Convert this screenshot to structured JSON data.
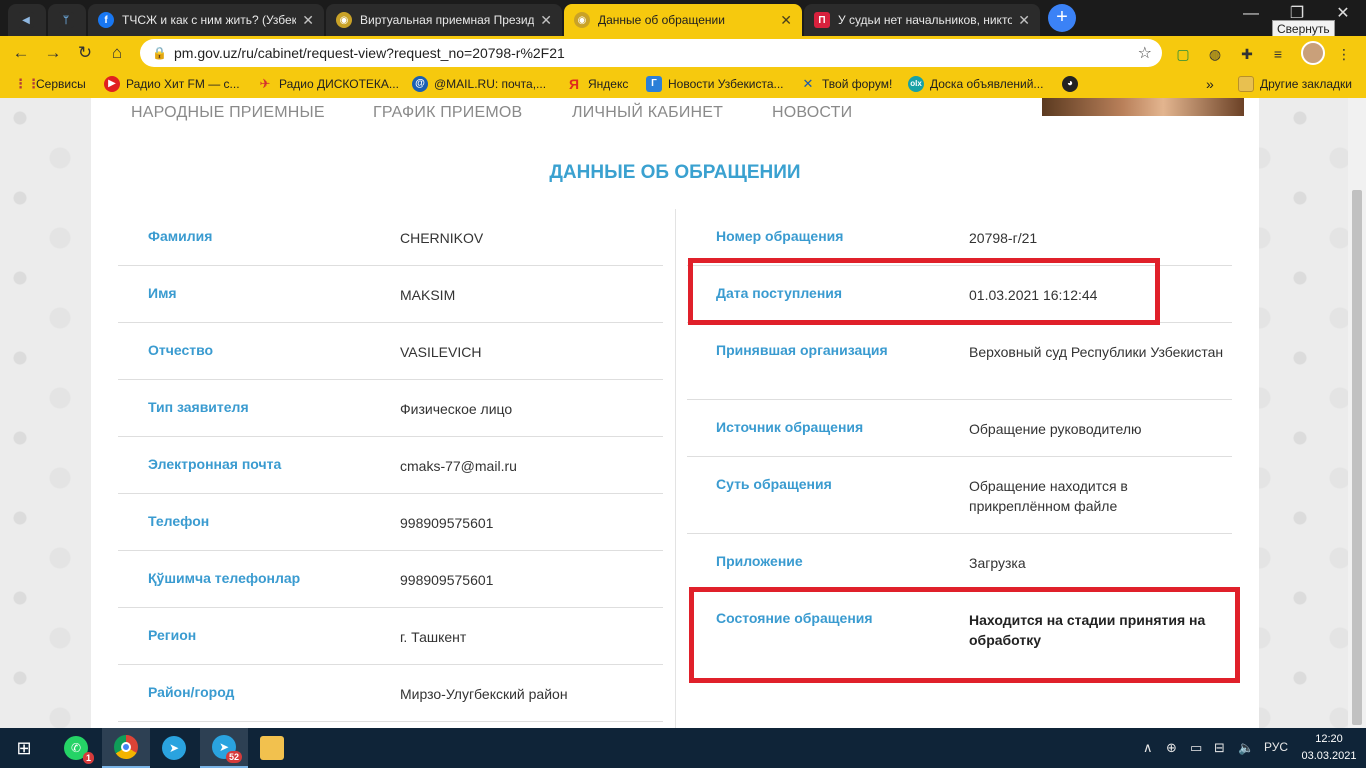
{
  "browser": {
    "tabs": [
      {
        "title": "",
        "favicon": "speaker-icon"
      },
      {
        "title": "",
        "favicon": "tree-icon"
      },
      {
        "title": "ТЧСЖ и как с ним жить? (Узбекистан)",
        "favicon": "facebook-icon"
      },
      {
        "title": "Виртуальная приемная Президента",
        "favicon": "emblem-icon"
      },
      {
        "title": "Данные об обращении",
        "favicon": "emblem-icon",
        "active": true
      },
      {
        "title": "У судьи нет начальников, никто",
        "favicon": "p-icon"
      }
    ],
    "new_tab": "+",
    "tooltip": "Свернуть",
    "url": "pm.gov.uz/ru/cabinet/request-view?request_no=20798-r%2F21",
    "bookmarks": [
      {
        "label": "Сервисы",
        "icon": "apps-icon"
      },
      {
        "label": "Радио Хит FM — с...",
        "icon": "play-icon"
      },
      {
        "label": "Радио ДИСКОТЕКА...",
        "icon": "rocket-icon"
      },
      {
        "label": "@MAIL.RU: почта,...",
        "icon": "mail-icon"
      },
      {
        "label": "Яндекс",
        "icon": "yandex-icon"
      },
      {
        "label": "Новости Узбекиста...",
        "icon": "news-icon"
      },
      {
        "label": "Твой форум!",
        "icon": "forum-icon"
      },
      {
        "label": "Доска объявлений...",
        "icon": "olx-icon"
      },
      {
        "label": "",
        "icon": "globe-icon"
      }
    ],
    "bookmarks_more": "»",
    "other_bookmarks": "Другие закладки"
  },
  "site": {
    "nav": [
      "НАРОДНЫЕ ПРИЕМНЫЕ",
      "ГРАФИК ПРИЕМОВ",
      "ЛИЧНЫЙ КАБИНЕТ",
      "НОВОСТИ"
    ],
    "title": "ДАННЫЕ ОБ ОБРАЩЕНИИ",
    "left_rows": [
      {
        "label": "Фамилия",
        "value": "CHERNIKOV"
      },
      {
        "label": "Имя",
        "value": "MAKSIM"
      },
      {
        "label": "Отчество",
        "value": "VASILEVICH"
      },
      {
        "label": "Тип заявителя",
        "value": "Физическое лицо"
      },
      {
        "label": "Электронная почта",
        "value": "cmaks-77@mail.ru"
      },
      {
        "label": "Телефон",
        "value": "998909575601"
      },
      {
        "label": "Қўшимча телефонлар",
        "value": "998909575601"
      },
      {
        "label": "Регион",
        "value": "г. Ташкент"
      },
      {
        "label": "Район/город",
        "value": "Мирзо-Улугбекский район"
      }
    ],
    "right_rows": [
      {
        "label": "Номер обращения",
        "value": "20798-г/21"
      },
      {
        "label": "Дата поступления",
        "value": "01.03.2021 16:12:44"
      },
      {
        "label": "Принявшая организация",
        "value": "Верховный суд Республики Узбекистан"
      },
      {
        "label": "Источник обращения",
        "value": "Обращение руководителю"
      },
      {
        "label": "Суть обращения",
        "value": "Обращение находится в прикреплённом файле"
      },
      {
        "label": "Приложение",
        "value": "Загрузка"
      },
      {
        "label": "Состояние обращения",
        "value": "Находится на стадии принятия на обработку"
      }
    ]
  },
  "taskbar": {
    "apps": [
      {
        "name": "whatsapp",
        "badge": "1"
      },
      {
        "name": "chrome",
        "badge": ""
      },
      {
        "name": "telegram",
        "badge": ""
      },
      {
        "name": "telegram-2",
        "badge": "52"
      },
      {
        "name": "explorer",
        "badge": ""
      }
    ],
    "language": "РУС",
    "time": "12:20",
    "date": "03.03.2021"
  }
}
